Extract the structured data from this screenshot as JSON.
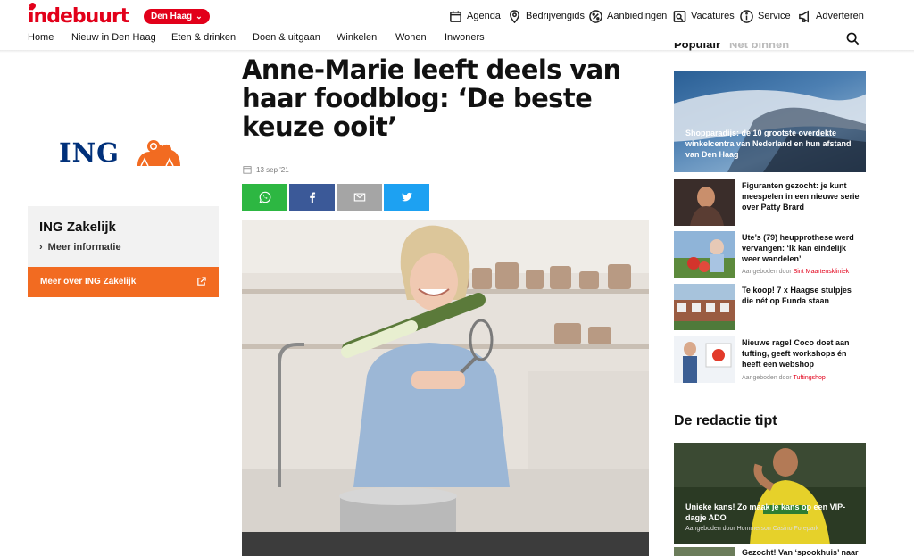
{
  "brand": {
    "logo_text": "indebuurt",
    "city": "Den Haag",
    "accent": "#e2001a"
  },
  "utility_nav": [
    {
      "label": "Agenda",
      "icon": "calendar-icon"
    },
    {
      "label": "Bedrijvengids",
      "icon": "location-pin-icon"
    },
    {
      "label": "Aanbiedingen",
      "icon": "percent-icon"
    },
    {
      "label": "Vacatures",
      "icon": "vacancy-icon"
    },
    {
      "label": "Service",
      "icon": "info-icon"
    },
    {
      "label": "Adverteren",
      "icon": "megaphone-icon"
    }
  ],
  "main_nav": [
    "Home",
    "Nieuw in Den Haag",
    "Eten & drinken",
    "Doen & uitgaan",
    "Winkelen",
    "Wonen",
    "Inwoners"
  ],
  "sponsor": {
    "logo_text": "ING",
    "title": "ING Zakelijk",
    "link": "Meer informatie",
    "button": "Meer over ING Zakelijk",
    "button_color": "#f26b21"
  },
  "article": {
    "headline": "Anne-Marie leeft deels van haar foodblog: ‘De beste keuze ooit’",
    "date": "13 sep '21",
    "share_buttons": [
      {
        "name": "whatsapp",
        "icon": "whatsapp-icon",
        "color": "#2db742"
      },
      {
        "name": "facebook",
        "icon": "facebook-icon",
        "color": "#3b5998"
      },
      {
        "name": "email",
        "icon": "mail-icon",
        "color": "#a5a5a5"
      },
      {
        "name": "twitter",
        "icon": "twitter-icon",
        "color": "#1da1f2"
      }
    ]
  },
  "right_column": {
    "tabs": [
      "Populair",
      "Net binnen"
    ],
    "featured": {
      "title": "Shopparadijs: de 10 grootste overdekte winkelcentra van Nederland en hun afstand van Den Haag"
    },
    "items": [
      {
        "title": "Figuranten gezocht: je kunt meespelen in een nieuwe serie over Patty Brard",
        "sponsor_prefix": "",
        "sponsor": ""
      },
      {
        "title": "Ute’s (79) heupprothese werd vervangen: ‘Ik kan eindelijk weer wandelen’",
        "sponsor_prefix": "Aangeboden door",
        "sponsor": "Sint Maartenskliniek"
      },
      {
        "title": "Te koop! 7 x Haagse stulpjes die nét op Funda staan",
        "sponsor_prefix": "",
        "sponsor": ""
      },
      {
        "title": "Nieuwe rage! Coco doet aan tufting, geeft workshops én heeft een webshop",
        "sponsor_prefix": "Aangeboden door",
        "sponsor": "Tuftingshop"
      }
    ],
    "tip_heading": "De redactie tipt",
    "tip": {
      "title": "Unieke kans! Zo maak je kans op een VIP-dagje ADO",
      "sponsor_prefix": "Aangeboden door",
      "sponsor": "Hommerson Casino Forepark"
    },
    "next_teaser": "Gezocht! Van ‘spookhuis’ naar"
  }
}
